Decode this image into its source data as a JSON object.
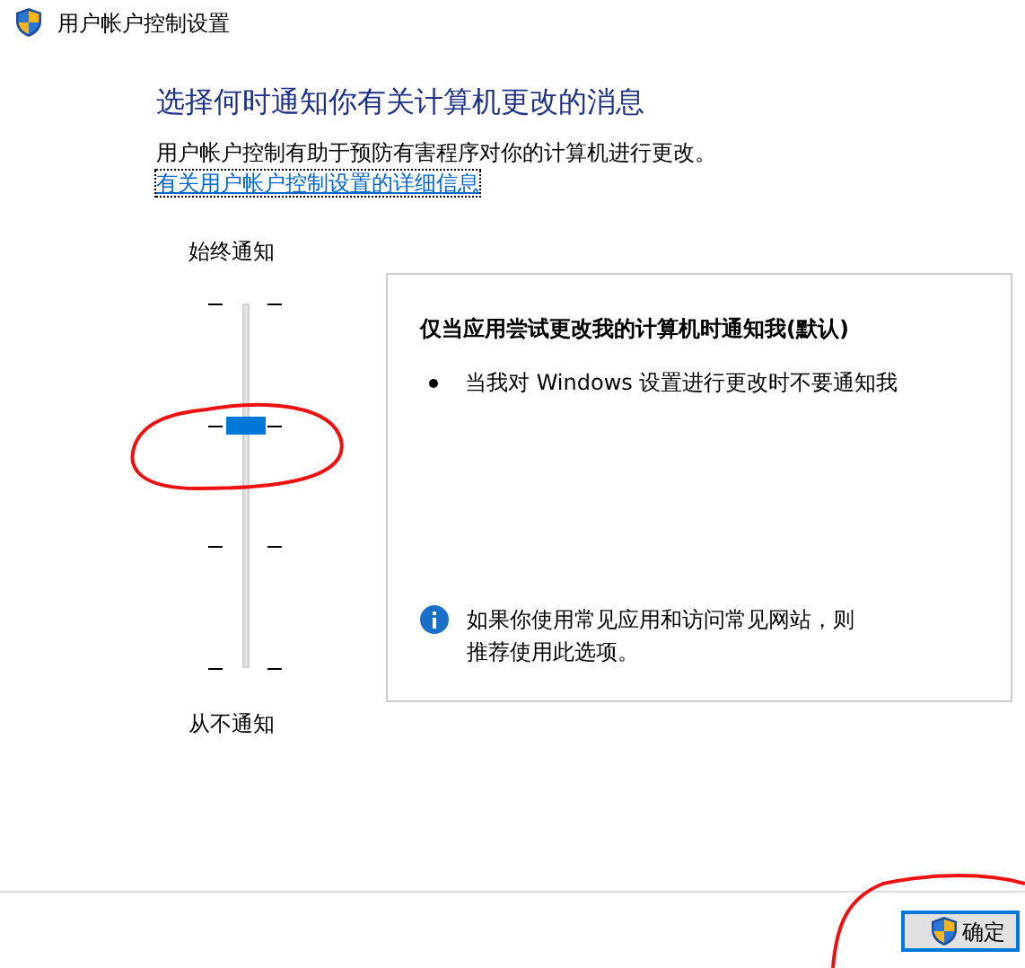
{
  "window": {
    "title": "用户帐户控制设置"
  },
  "heading": "选择何时通知你有关计算机更改的消息",
  "description": "用户帐户控制有助于预防有害程序对你的计算机进行更改。",
  "link": "有关用户帐户控制设置的详细信息",
  "slider": {
    "top_label": "始终通知",
    "bottom_label": "从不通知",
    "level": 0.67
  },
  "panel": {
    "title": "仅当应用尝试更改我的计算机时通知我(默认)",
    "bullets": [
      "当我对 Windows 设置进行更改时不要通知我"
    ],
    "info": "如果你使用常见应用和访问常见网站，则推荐使用此选项。"
  },
  "buttons": [
    {
      "label": "确定",
      "selected": true
    }
  ]
}
